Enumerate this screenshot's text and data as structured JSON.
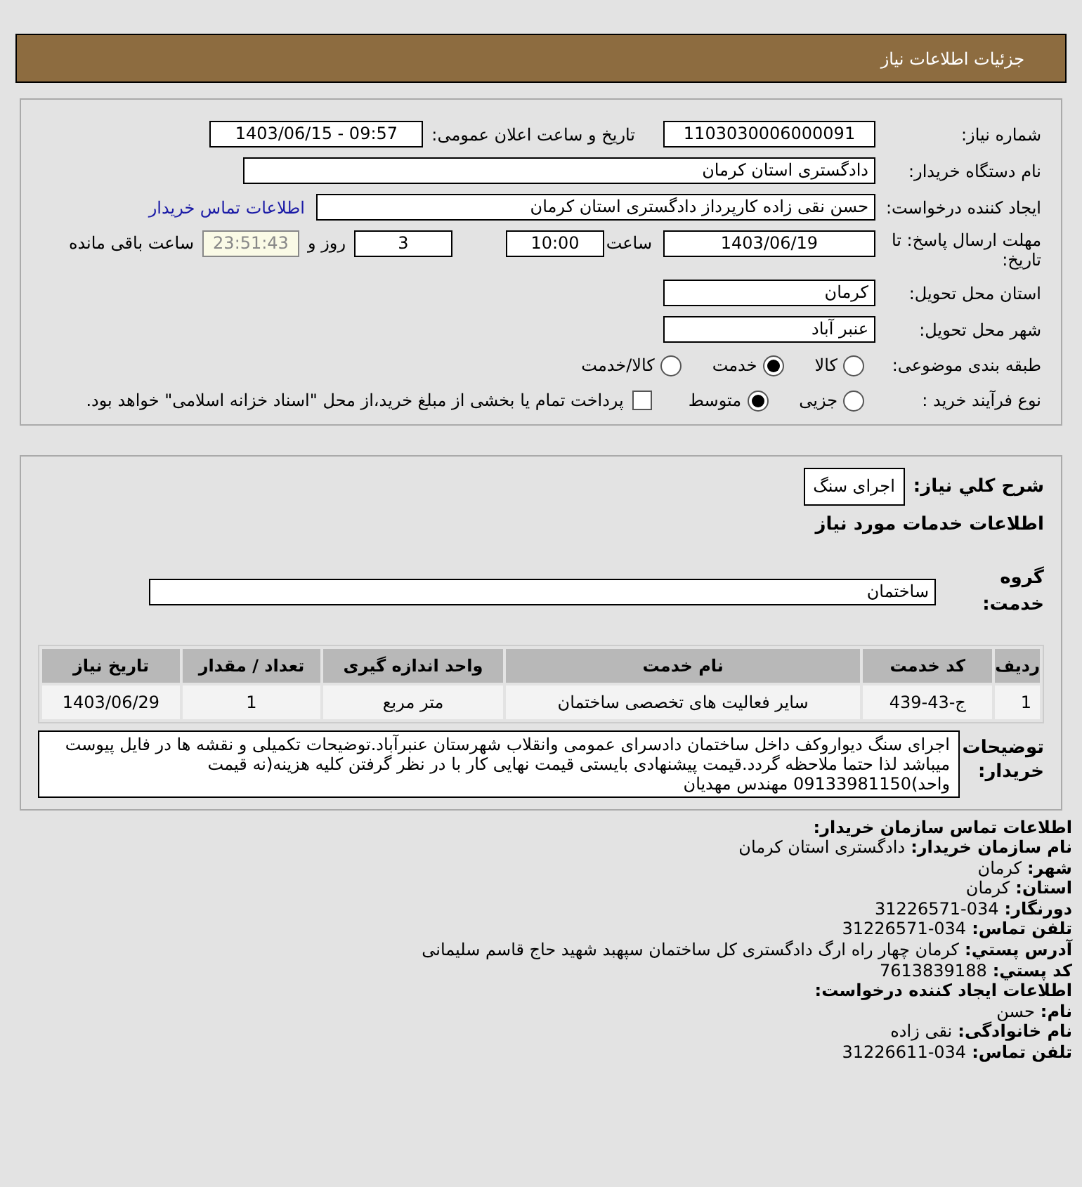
{
  "header": {
    "title": "جزئیات اطلاعات نیاز"
  },
  "need_info": {
    "need_number": {
      "label": "شماره نیاز:",
      "value": "1103030006000091"
    },
    "announce_datetime": {
      "label": "تاریخ و ساعت اعلان عمومی:",
      "value": "1403/06/15 - 09:57"
    },
    "buyer_org": {
      "label": "نام دستگاه خریدار:",
      "value": "دادگستری استان کرمان"
    },
    "requester": {
      "label": "ایجاد کننده درخواست:",
      "value": "حسن نقی زاده کارپرداز دادگستری استان کرمان",
      "contact_link": "اطلاعات تماس خریدار"
    },
    "deadline": {
      "label": "مهلت ارسال پاسخ: تا تاریخ:",
      "date": "1403/06/19",
      "time_label": "ساعت",
      "time": "10:00",
      "days": "3",
      "days_label": "روز و",
      "remaining": "23:51:43",
      "remaining_label": "ساعت باقی مانده"
    },
    "delivery_province": {
      "label": "استان محل تحویل:",
      "value": "کرمان"
    },
    "delivery_city": {
      "label": "شهر محل تحویل:",
      "value": "عنبر آباد"
    },
    "category": {
      "label": "طبقه بندی موضوعی:",
      "options": [
        {
          "label": "کالا",
          "selected": false
        },
        {
          "label": "خدمت",
          "selected": true
        },
        {
          "label": "کالا/خدمت",
          "selected": false
        }
      ]
    },
    "purchase_process": {
      "label": "نوع فرآیند خرید :",
      "options": [
        {
          "label": "جزیی",
          "selected": false
        },
        {
          "label": "متوسط",
          "selected": true
        }
      ],
      "treasury": {
        "checked": false,
        "label": "پرداخت تمام یا بخشی از مبلغ خرید،از محل \"اسناد خزانه اسلامی\" خواهد بود."
      }
    }
  },
  "service_section": {
    "summary_label": "شرح کلي نیاز:",
    "summary": "اجرای سنگ",
    "services_heading": "اطلاعات خدمات مورد نیاز",
    "service_group": {
      "label": "گروه خدمت:",
      "value": "ساختمان"
    },
    "table": {
      "columns": [
        "ردیف",
        "کد خدمت",
        "نام خدمت",
        "واحد اندازه گیری",
        "تعداد / مقدار",
        "تاریخ نیاز"
      ],
      "rows": [
        [
          "1",
          "ج-43-439",
          "سایر فعالیت های تخصصی ساختمان",
          "متر مربع",
          "1",
          "1403/06/29"
        ]
      ]
    },
    "buyer_notes": {
      "label": "توضیحات خریدار:",
      "text": "اجرای سنگ دیواروکف داخل ساختمان دادسرای عمومی وانقلاب شهرستان عنبرآباد.توضیحات تکمیلی و نقشه ها در فایل پیوست میباشد لذا حتما ملاحظه گردد.قیمت پیشنهادی بایستی قیمت نهایی کار با در نظر گرفتن کلیه هزینه(نه قیمت واحد)09133981150 مهندس مهدیان"
    }
  },
  "contact": [
    {
      "kind": "heading",
      "text": "اطلاعات تماس سازمان خریدار:"
    },
    {
      "kind": "field",
      "label": "نام سازمان خریدار:",
      "value": "دادگستری استان کرمان"
    },
    {
      "kind": "field",
      "label": "شهر:",
      "value": "کرمان"
    },
    {
      "kind": "field",
      "label": "استان:",
      "value": "کرمان"
    },
    {
      "kind": "field",
      "label": "دورنگار:",
      "value": "31226571-034"
    },
    {
      "kind": "field",
      "label": "تلفن تماس:",
      "value": "31226571-034"
    },
    {
      "kind": "field",
      "label": "آدرس پستي:",
      "value": "کرمان چهار راه ارگ دادگستری کل ساختمان سپهبد شهید حاج قاسم سلیمانی"
    },
    {
      "kind": "field",
      "label": "کد پستي:",
      "value": "7613839188"
    },
    {
      "kind": "heading",
      "text": "اطلاعات ایجاد کننده درخواست:"
    },
    {
      "kind": "field",
      "label": "نام:",
      "value": "حسن"
    },
    {
      "kind": "field",
      "label": "نام خانوادگی:",
      "value": "نقی زاده"
    },
    {
      "kind": "field",
      "label": "تلفن تماس:",
      "value": "31226611-034"
    }
  ]
}
